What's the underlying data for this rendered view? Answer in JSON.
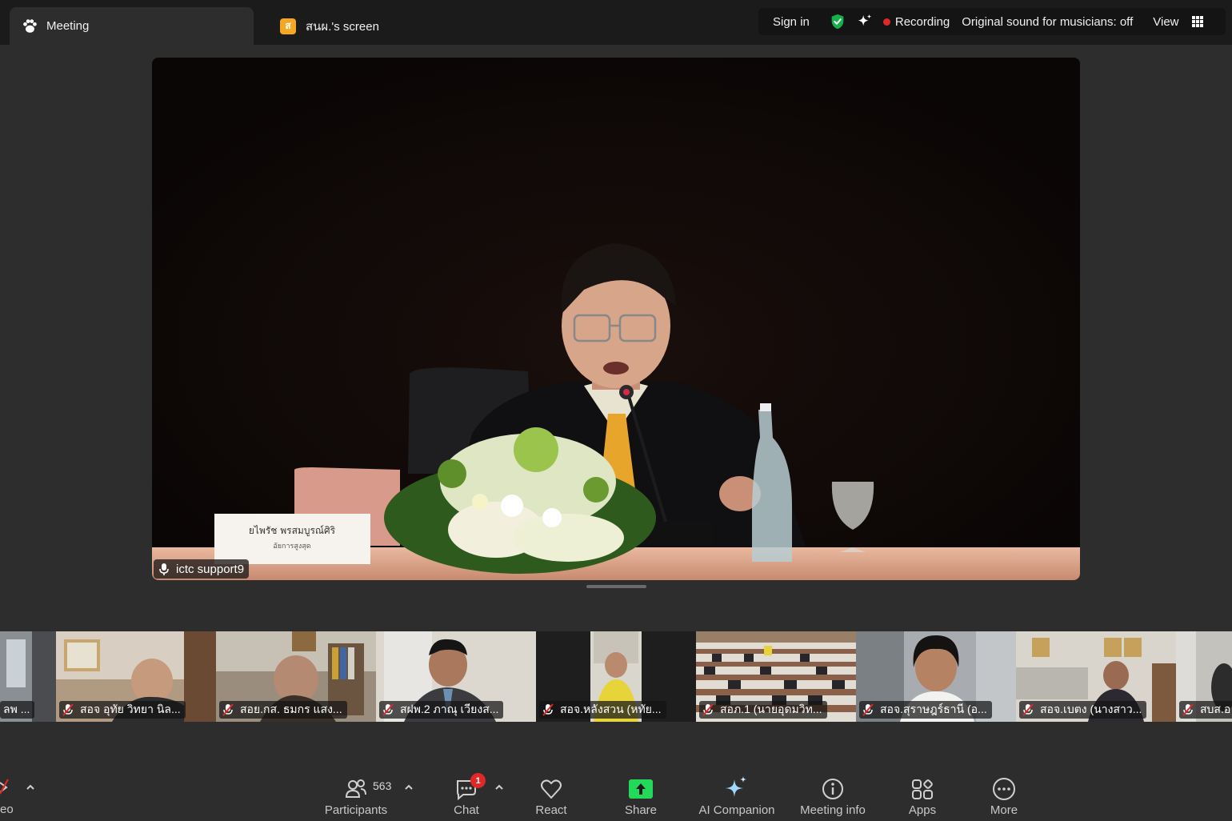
{
  "tabs": {
    "meeting_label": "Meeting",
    "screen_icon_letter": "ส",
    "screen_label": "สนผ.'s screen"
  },
  "status": {
    "sign_in": "Sign in",
    "recording": "Recording",
    "original_sound": "Original sound for musicians: off",
    "view": "View"
  },
  "main_video": {
    "speaker_name": "ictc support9",
    "placard_name": "ยไพรัช พรสมบูรณ์ศิริ",
    "placard_title": "อัยการสูงสุด"
  },
  "participants": [
    {
      "name": "ลพ ..."
    },
    {
      "name": "สอจ อุทัย วิทยา นิล..."
    },
    {
      "name": "สอย.กส. ธมกร แสง..."
    },
    {
      "name": "สฝพ.2 ภาณุ เวียงส..."
    },
    {
      "name": "สอจ.หลังสวน (หทัย..."
    },
    {
      "name": "สอภ.1 (นายอุดมวิท..."
    },
    {
      "name": "สอจ.สุราษฎร์ธานี (อ..."
    },
    {
      "name": "สอจ.เบตง (นางสาว..."
    },
    {
      "name": "สบส.อ"
    }
  ],
  "toolbar": {
    "video_partial": "eo",
    "participants_count": "563",
    "participants": "Participants",
    "chat": "Chat",
    "chat_badge": "1",
    "react": "React",
    "share": "Share",
    "ai_companion": "AI Companion",
    "meeting_info": "Meeting info",
    "apps": "Apps",
    "more": "More"
  },
  "colors": {
    "background": "#2d2d2d",
    "topbar": "#1b1b1b",
    "share_green": "#23d959",
    "recording_red": "#e02828",
    "shield_green": "#17b14b"
  }
}
